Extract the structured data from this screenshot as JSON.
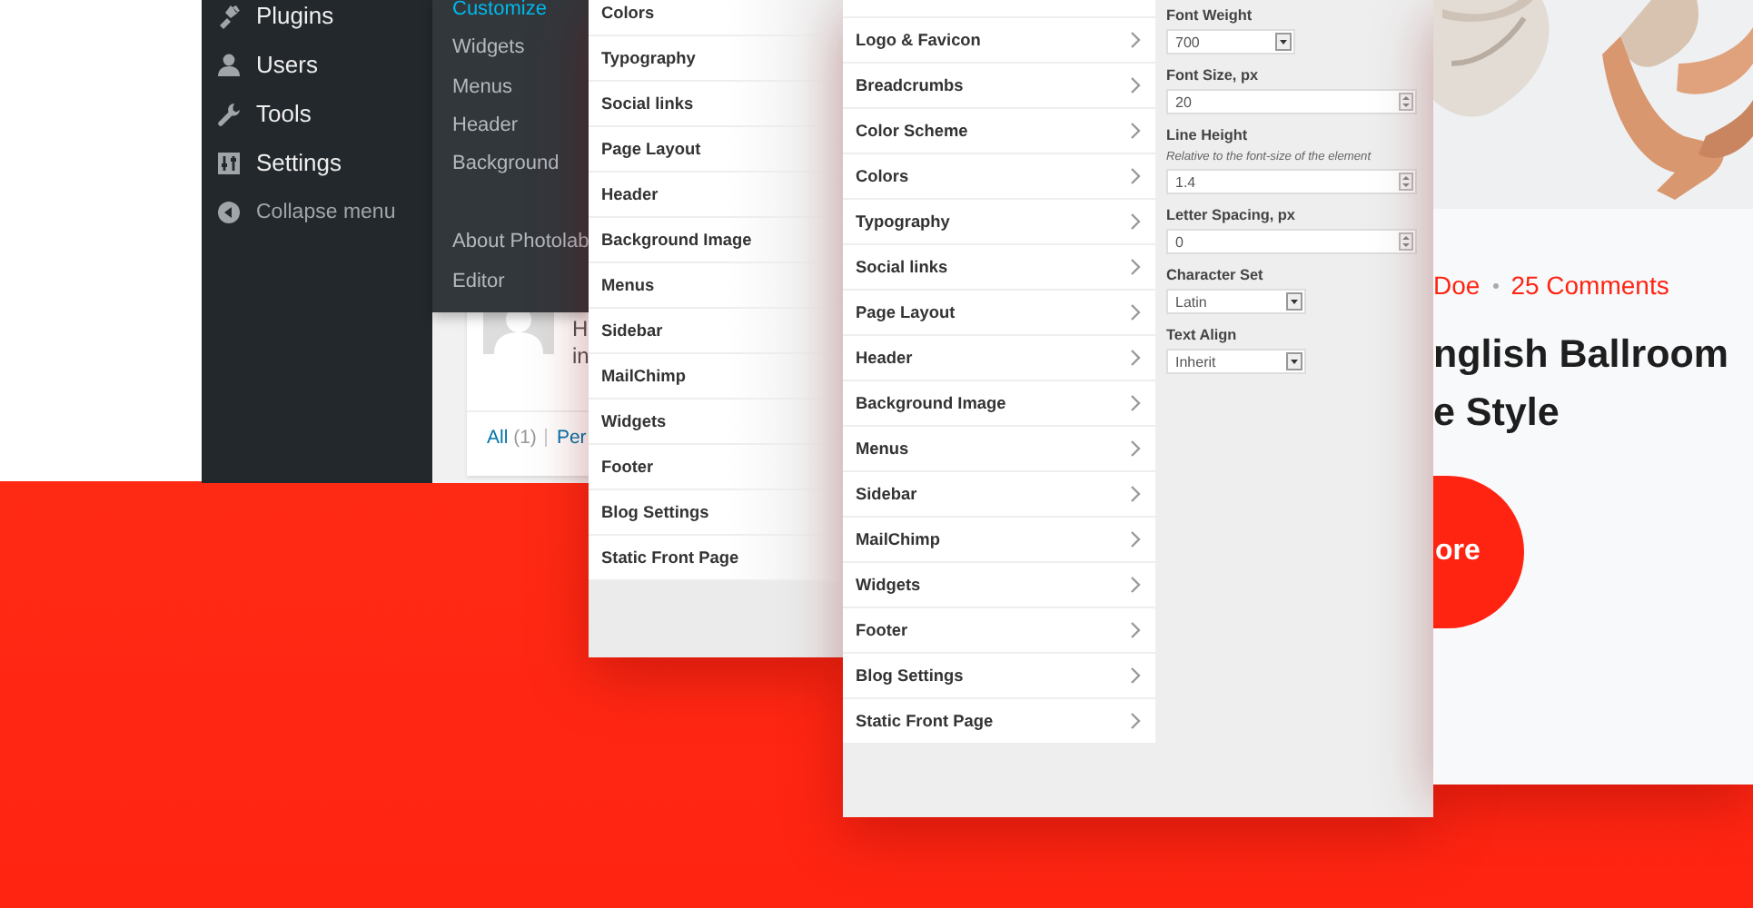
{
  "admin_menu": {
    "items": [
      {
        "kind": "link",
        "label": "Plugins"
      },
      {
        "kind": "link",
        "label": "Users"
      },
      {
        "kind": "link",
        "label": "Tools"
      },
      {
        "kind": "link",
        "label": "Settings"
      },
      {
        "kind": "collapse",
        "label": "Collapse menu"
      }
    ]
  },
  "submenu": {
    "groups": [
      [
        {
          "label": "Customize",
          "selected": true
        },
        {
          "label": "Widgets",
          "selected": false
        },
        {
          "label": "Menus",
          "selected": false
        },
        {
          "label": "Header",
          "selected": false
        },
        {
          "label": "Background",
          "selected": false
        }
      ],
      [
        {
          "label": "About Photolab",
          "selected": false
        },
        {
          "label": "Editor",
          "selected": false
        }
      ]
    ]
  },
  "comments": {
    "excerpt_lines": [
      "H",
      "in"
    ],
    "filters": [
      {
        "label": "All",
        "count": "(1)"
      },
      {
        "label": "Per"
      }
    ]
  },
  "customizer_back": {
    "sections": [
      "Colors",
      "Typography",
      "Social links",
      "Page Layout",
      "Header",
      "Background Image",
      "Menus",
      "Sidebar",
      "MailChimp",
      "Widgets",
      "Footer",
      "Blog Settings",
      "Static Front Page"
    ]
  },
  "customizer_front": {
    "sections": [
      "Logo & Favicon",
      "Breadcrumbs",
      "Color Scheme",
      "Colors",
      "Typography",
      "Social links",
      "Page Layout",
      "Header",
      "Background Image",
      "Menus",
      "Sidebar",
      "MailChimp",
      "Widgets",
      "Footer",
      "Blog Settings",
      "Static Front Page"
    ],
    "controls": [
      {
        "kind": "select",
        "label": "Font Weight",
        "value": "700"
      },
      {
        "kind": "number",
        "label": "Font Size, px",
        "value": "20"
      },
      {
        "kind": "number",
        "label": "Line Height",
        "description": "Relative to the font-size of the element",
        "value": "1.4"
      },
      {
        "kind": "number",
        "label": "Letter Spacing, px",
        "value": "0"
      },
      {
        "kind": "select",
        "label": "Character Set",
        "value": "Latin"
      },
      {
        "kind": "select",
        "label": "Text Align",
        "value": "Inherit"
      }
    ]
  },
  "post_preview": {
    "meta": [
      "Doe",
      "25 Comments"
    ],
    "title_lines": [
      "nglish Ballroom",
      "e Style"
    ],
    "button": "ore"
  }
}
